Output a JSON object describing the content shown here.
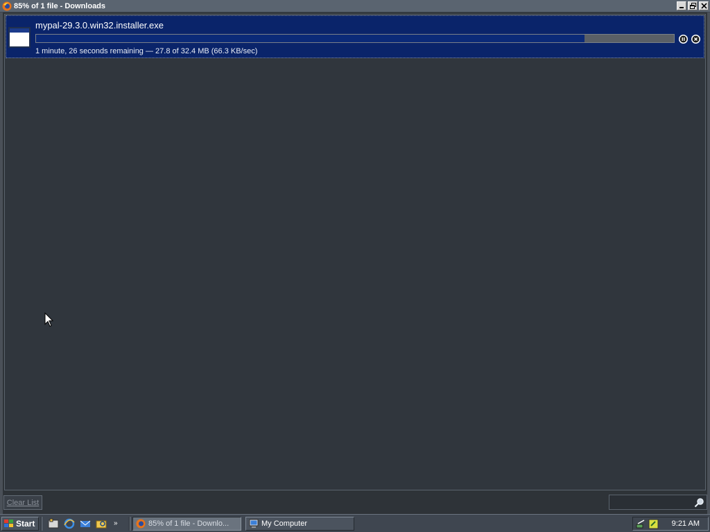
{
  "window": {
    "title": "85% of 1 file - Downloads"
  },
  "download": {
    "filename": "mypal-29.3.0.win32.installer.exe",
    "status": "1 minute, 26 seconds remaining — 27.8 of 32.4 MB (66.3 KB/sec)",
    "progress": 0.86
  },
  "bottom_bar": {
    "clear_list_label": "Clear List",
    "search_placeholder": ""
  },
  "taskbar": {
    "start_label": "Start",
    "quick_launch_overflow": "»",
    "tasks": [
      {
        "label": "85% of 1 file - Downlo...",
        "icon": "firefox-icon",
        "active": true
      },
      {
        "label": "My Computer",
        "icon": "computer-icon",
        "active": false
      }
    ],
    "clock": "9:21 AM"
  }
}
